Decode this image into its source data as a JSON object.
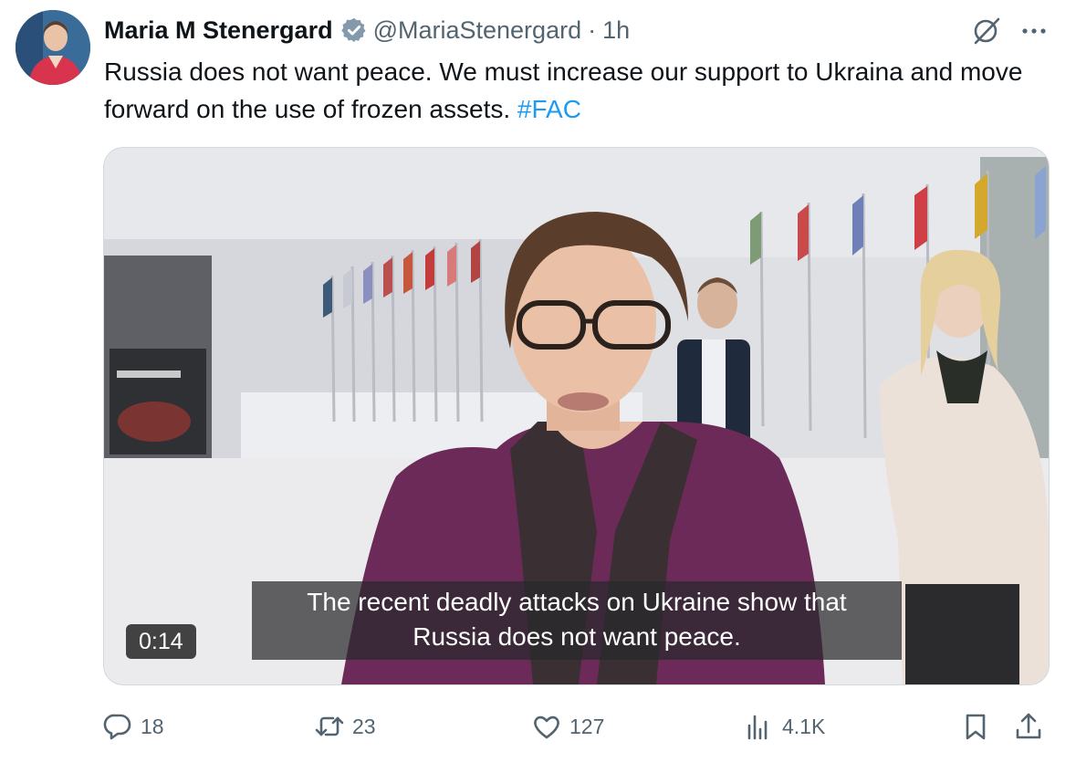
{
  "author": {
    "name": "Maria M Stenergard",
    "handle": "@MariaStenergard",
    "separator": "·",
    "time": "1h",
    "avatar_icon": "profile-photo"
  },
  "tweet": {
    "text": "Russia does not want peace. We must increase our support to Ukraina and move forward on the use of frozen assets.",
    "hashtag": "#FAC"
  },
  "video": {
    "subtitle_line1": "The recent deadly attacks on Ukraine show that",
    "subtitle_line2": "Russia does not want peace.",
    "duration": "0:14"
  },
  "actions": {
    "replies": "18",
    "reposts": "23",
    "likes": "127",
    "views": "4.1K"
  },
  "icons": [
    "verified-badge-icon",
    "grok-icon",
    "more-icon",
    "reply-icon",
    "repost-icon",
    "like-icon",
    "views-icon",
    "bookmark-icon",
    "share-icon"
  ],
  "colors": {
    "accent": "#1d9bf0",
    "muted": "#536471",
    "text": "#0f1419"
  }
}
